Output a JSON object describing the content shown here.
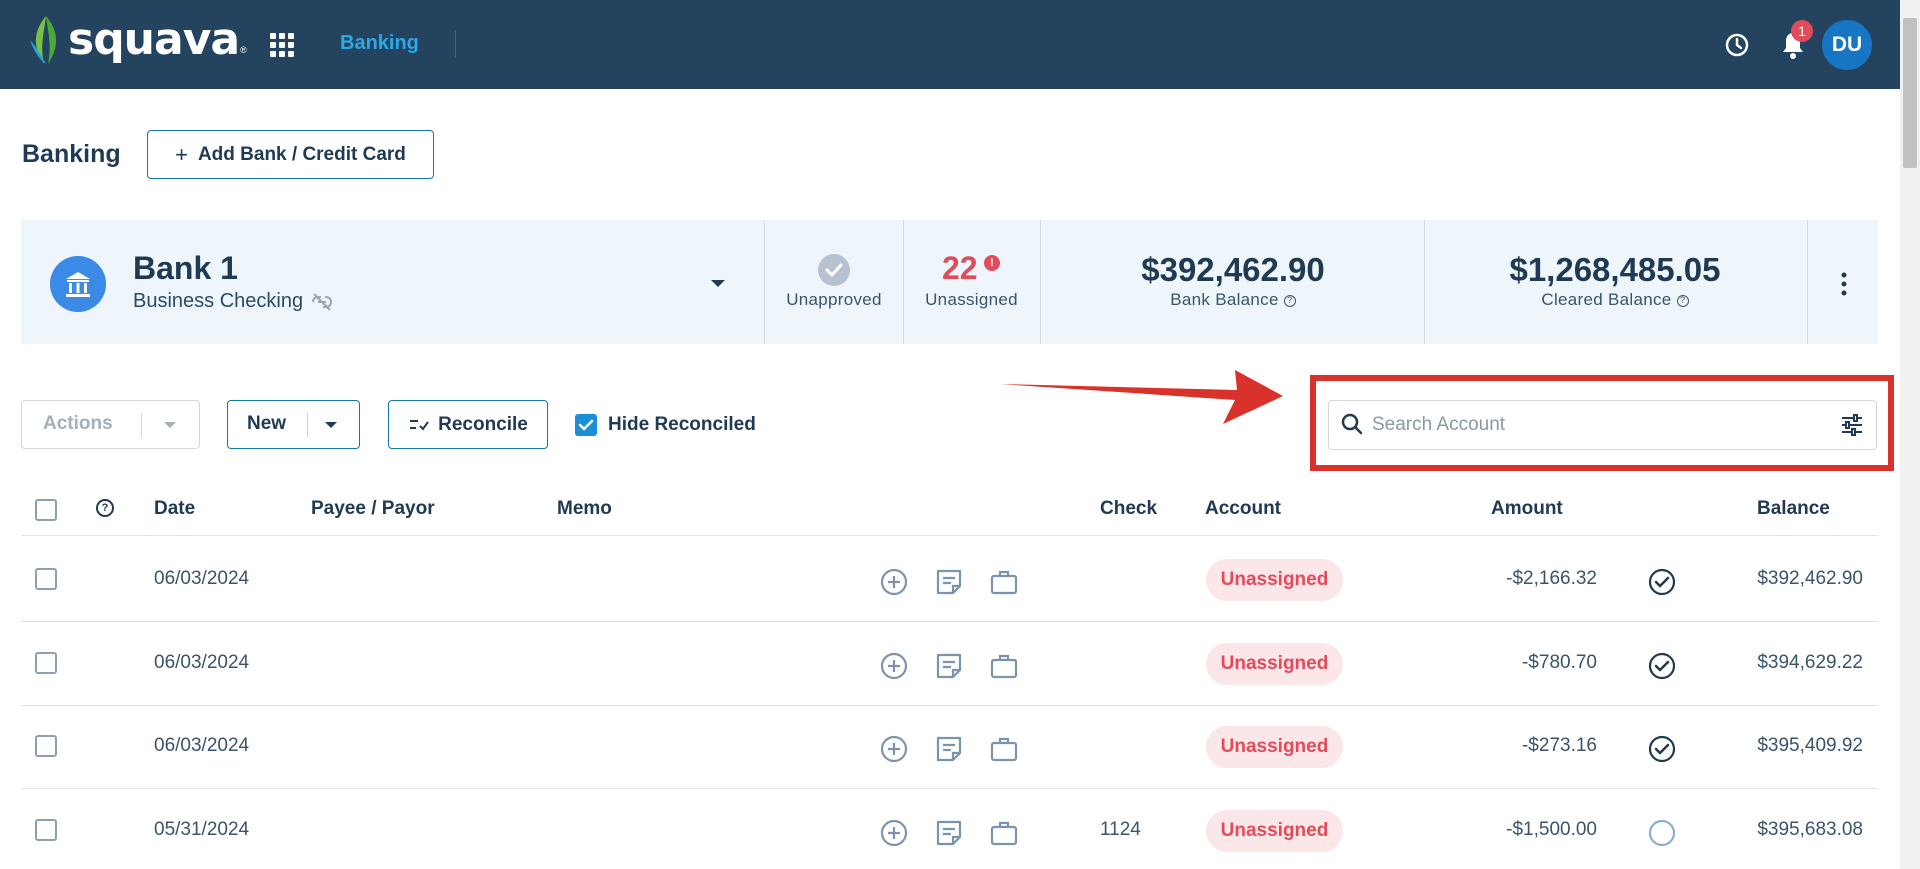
{
  "app": {
    "logo_text": "squava",
    "logo_reg": "®",
    "nav_active": "Banking",
    "notifications_count": "1",
    "user_initials": "DU"
  },
  "page": {
    "title": "Banking",
    "add_bank_label": "Add Bank / Credit Card"
  },
  "bank": {
    "name": "Bank 1",
    "type": "Business Checking",
    "unapproved_label": "Unapproved",
    "unassigned_count": "22",
    "unassigned_label": "Unassigned",
    "bank_balance": "$392,462.90",
    "bank_balance_label": "Bank Balance",
    "cleared_balance": "$1,268,485.05",
    "cleared_balance_label": "Cleared Balance"
  },
  "toolbar": {
    "actions_label": "Actions",
    "new_label": "New",
    "reconcile_label": "Reconcile",
    "hide_reconciled_label": "Hide Reconciled",
    "hide_reconciled_checked": true,
    "search_placeholder": "Search Account",
    "search_value": ""
  },
  "table": {
    "headers": {
      "date": "Date",
      "payee": "Payee / Payor",
      "memo": "Memo",
      "check": "Check",
      "account": "Account",
      "amount": "Amount",
      "balance": "Balance"
    },
    "rows": [
      {
        "date": "06/03/2024",
        "check": "",
        "account": "Unassigned",
        "amount": "-$2,166.32",
        "reconciled": true,
        "balance": "$392,462.90"
      },
      {
        "date": "06/03/2024",
        "check": "",
        "account": "Unassigned",
        "amount": "-$780.70",
        "reconciled": true,
        "balance": "$394,629.22"
      },
      {
        "date": "06/03/2024",
        "check": "",
        "account": "Unassigned",
        "amount": "-$273.16",
        "reconciled": true,
        "balance": "$395,409.92"
      },
      {
        "date": "05/31/2024",
        "check": "1124",
        "account": "Unassigned",
        "amount": "-$1,500.00",
        "reconciled": false,
        "balance": "$395,683.08"
      }
    ]
  },
  "colors": {
    "nav_bg": "#24435e",
    "accent": "#1676a8",
    "link": "#2aa8e8",
    "danger": "#e24b5b",
    "highlight": "#d8322a"
  }
}
